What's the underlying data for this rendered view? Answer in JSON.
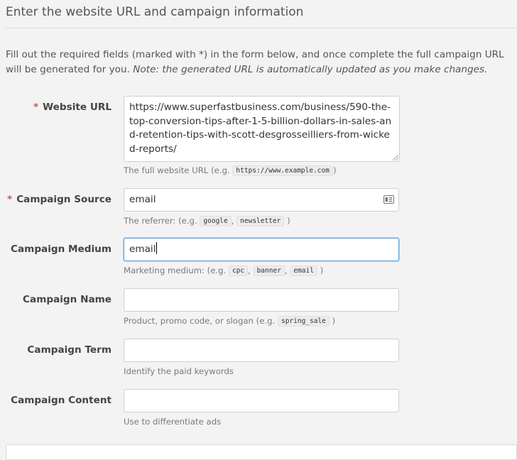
{
  "section": {
    "title": "Enter the website URL and campaign information",
    "intro_text": "Fill out the required fields (marked with *) in the form below, and once complete the full campaign URL will be generated for you. ",
    "intro_note": "Note: the generated URL is automatically updated as you make changes."
  },
  "required_marker": "*",
  "fields": {
    "website_url": {
      "label": "Website URL",
      "required": true,
      "value": "https://www.superfastbusiness.com/business/590-the-top-conversion-tips-after-1-5-billion-dollars-in-sales-and-retention-tips-with-scott-desgrosseilliers-from-wicked-reports/",
      "help_prefix": "The full website URL (e.g. ",
      "help_code": "https://www.example.com",
      "help_suffix": ")"
    },
    "campaign_source": {
      "label": "Campaign Source",
      "required": true,
      "value": "email",
      "help_prefix": "The referrer: (e.g. ",
      "help_code_1": "google",
      "help_sep_1": ", ",
      "help_code_2": "newsletter",
      "help_suffix": ")"
    },
    "campaign_medium": {
      "label": "Campaign Medium",
      "required": false,
      "value": "email",
      "focused": true,
      "help_prefix": "Marketing medium: (e.g. ",
      "help_code_1": "cpc",
      "help_sep_1": ", ",
      "help_code_2": "banner",
      "help_sep_2": ", ",
      "help_code_3": "email",
      "help_suffix": ")"
    },
    "campaign_name": {
      "label": "Campaign Name",
      "required": false,
      "value": "",
      "help_prefix": "Product, promo code, or slogan (e.g. ",
      "help_code": "spring_sale",
      "help_suffix": ")"
    },
    "campaign_term": {
      "label": "Campaign Term",
      "required": false,
      "value": "",
      "help": "Identify the paid keywords"
    },
    "campaign_content": {
      "label": "Campaign Content",
      "required": false,
      "value": "",
      "help": "Use to differentiate ads"
    }
  },
  "icons": {
    "autofill": "contact-card-icon"
  },
  "colors": {
    "required": "#d9534f",
    "focus_border": "#5b9dd9",
    "page_background": "#f3f3f3"
  }
}
